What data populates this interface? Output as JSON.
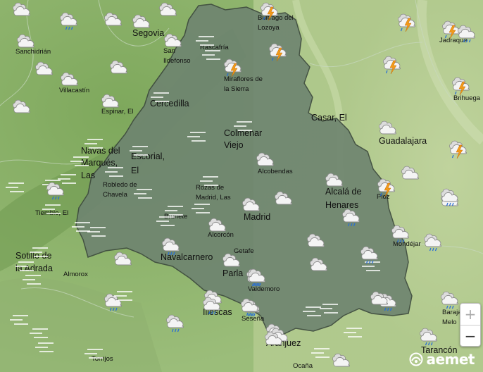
{
  "map": {
    "colors": {
      "region_fill": "#6f8570",
      "region_border": "#3d4a3e",
      "terrain_light": "#a9c38a",
      "terrain_dark": "#7aa05a"
    },
    "places": [
      {
        "name": "Segovia",
        "size": "big"
      },
      {
        "name": "Buitrago del",
        "size": "sm"
      },
      {
        "name": "Lozoya",
        "size": "sm"
      },
      {
        "name": "Jadraque",
        "size": "sm"
      },
      {
        "name": "Sanchidrián",
        "size": "sm"
      },
      {
        "name": "San",
        "size": "sm"
      },
      {
        "name": "Ildefonso",
        "size": "sm"
      },
      {
        "name": "Rascafría",
        "size": "sm"
      },
      {
        "name": "Miraflores de",
        "size": "sm"
      },
      {
        "name": "la Sierra",
        "size": "sm"
      },
      {
        "name": "Villacastín",
        "size": "sm"
      },
      {
        "name": "Brihuega",
        "size": "sm"
      },
      {
        "name": "Cercedilla",
        "size": "big"
      },
      {
        "name": "Espinar, El",
        "size": "sm"
      },
      {
        "name": "Casar, El",
        "size": "big"
      },
      {
        "name": "Colmenar",
        "size": "big"
      },
      {
        "name": "Viejo",
        "size": "big"
      },
      {
        "name": "Guadalajara",
        "size": "big"
      },
      {
        "name": "Navas del",
        "size": "big"
      },
      {
        "name": "Marqués,",
        "size": "big"
      },
      {
        "name": "Las",
        "size": "big"
      },
      {
        "name": "Escorial,",
        "size": "big"
      },
      {
        "name": "El",
        "size": "big"
      },
      {
        "name": "Alcobendas",
        "size": "sm"
      },
      {
        "name": "Robledo de",
        "size": "sm"
      },
      {
        "name": "Chavela",
        "size": "sm"
      },
      {
        "name": "Rozas de",
        "size": "sm"
      },
      {
        "name": "Madrid, Las",
        "size": "sm"
      },
      {
        "name": "Alcalá de",
        "size": "big"
      },
      {
        "name": "Henares",
        "size": "big"
      },
      {
        "name": "Pioz",
        "size": "sm"
      },
      {
        "name": "Tiemblo, El",
        "size": "sm"
      },
      {
        "name": "Brunete",
        "size": "sm"
      },
      {
        "name": "Madrid",
        "size": "big"
      },
      {
        "name": "Alcorcón",
        "size": "sm"
      },
      {
        "name": "Mondéjar",
        "size": "sm"
      },
      {
        "name": "Sotillo de",
        "size": "big"
      },
      {
        "name": "la Adrada",
        "size": "big"
      },
      {
        "name": "Navalcarnero",
        "size": "big"
      },
      {
        "name": "Getafe",
        "size": "sm"
      },
      {
        "name": "Parla",
        "size": "big"
      },
      {
        "name": "Almorox",
        "size": "sm"
      },
      {
        "name": "Valdemoro",
        "size": "sm"
      },
      {
        "name": "Illescas",
        "size": "big"
      },
      {
        "name": "Barajas de",
        "size": "sm"
      },
      {
        "name": "Melo",
        "size": "sm"
      },
      {
        "name": "Seseña",
        "size": "sm"
      },
      {
        "name": "Aranjuez",
        "size": "big"
      },
      {
        "name": "Tarancón",
        "size": "big"
      },
      {
        "name": "Torrijos",
        "size": "sm"
      },
      {
        "name": "Ocaña",
        "size": "sm"
      }
    ],
    "symbols": [
      {
        "kind": "cloud"
      },
      {
        "kind": "cloud-rain"
      },
      {
        "kind": "cloud"
      },
      {
        "kind": "cloud"
      },
      {
        "kind": "cloud"
      },
      {
        "kind": "storm"
      },
      {
        "kind": "storm"
      },
      {
        "kind": "storm"
      },
      {
        "kind": "cloud"
      },
      {
        "kind": "cloud"
      },
      {
        "kind": "fog"
      },
      {
        "kind": "storm"
      },
      {
        "kind": "fog"
      },
      {
        "kind": "cloud"
      },
      {
        "kind": "storm"
      },
      {
        "kind": "storm"
      },
      {
        "kind": "cloud"
      },
      {
        "kind": "cloud"
      },
      {
        "kind": "cloud"
      },
      {
        "kind": "fog"
      },
      {
        "kind": "cloud"
      },
      {
        "kind": "storm"
      },
      {
        "kind": "cloud"
      },
      {
        "kind": "fog"
      },
      {
        "kind": "cloud"
      },
      {
        "kind": "fog"
      },
      {
        "kind": "fog"
      },
      {
        "kind": "fog"
      },
      {
        "kind": "fog"
      },
      {
        "kind": "cloud"
      },
      {
        "kind": "storm"
      },
      {
        "kind": "fog"
      },
      {
        "kind": "fog"
      },
      {
        "kind": "fog"
      },
      {
        "kind": "fog"
      },
      {
        "kind": "fog"
      },
      {
        "kind": "cloud"
      },
      {
        "kind": "fog"
      },
      {
        "kind": "fog"
      },
      {
        "kind": "cloud"
      },
      {
        "kind": "fog"
      },
      {
        "kind": "cloud-rain"
      },
      {
        "kind": "cloud"
      },
      {
        "kind": "fog"
      },
      {
        "kind": "fog"
      },
      {
        "kind": "fog"
      },
      {
        "kind": "storm"
      },
      {
        "kind": "fog"
      },
      {
        "kind": "cloud"
      },
      {
        "kind": "cloud"
      },
      {
        "kind": "cloud"
      },
      {
        "kind": "cloud-rain"
      },
      {
        "kind": "cloud"
      },
      {
        "kind": "fog"
      },
      {
        "kind": "cloud-rain"
      },
      {
        "kind": "cloud-rain"
      },
      {
        "kind": "fog"
      },
      {
        "kind": "fog"
      },
      {
        "kind": "fog"
      },
      {
        "kind": "cloud-rain"
      },
      {
        "kind": "cloud"
      },
      {
        "kind": "cloud-rain"
      },
      {
        "kind": "cloud-rain"
      },
      {
        "kind": "fog"
      },
      {
        "kind": "cloud"
      },
      {
        "kind": "cloud-rain"
      },
      {
        "kind": "cloud-rain"
      },
      {
        "kind": "cloud-rain"
      },
      {
        "kind": "cloud"
      },
      {
        "kind": "cloud-rain"
      },
      {
        "kind": "cloud-rain"
      },
      {
        "kind": "fog"
      },
      {
        "kind": "cloud-rain"
      },
      {
        "kind": "fog"
      },
      {
        "kind": "cloud-rain"
      },
      {
        "kind": "cloud-rain"
      },
      {
        "kind": "cloud-rain"
      },
      {
        "kind": "fog"
      },
      {
        "kind": "fog"
      },
      {
        "kind": "cloud"
      },
      {
        "kind": "cloud-rain"
      },
      {
        "kind": "fog"
      },
      {
        "kind": "fog"
      },
      {
        "kind": "cloud-rain"
      },
      {
        "kind": "fog"
      },
      {
        "kind": "fog"
      },
      {
        "kind": "cloud"
      },
      {
        "kind": "cloud"
      },
      {
        "kind": "cloud-rain"
      },
      {
        "kind": "cloud"
      }
    ]
  },
  "controls": {
    "zoom_in": "+",
    "zoom_out": "−"
  },
  "brand": {
    "logo_text": "aemet"
  }
}
